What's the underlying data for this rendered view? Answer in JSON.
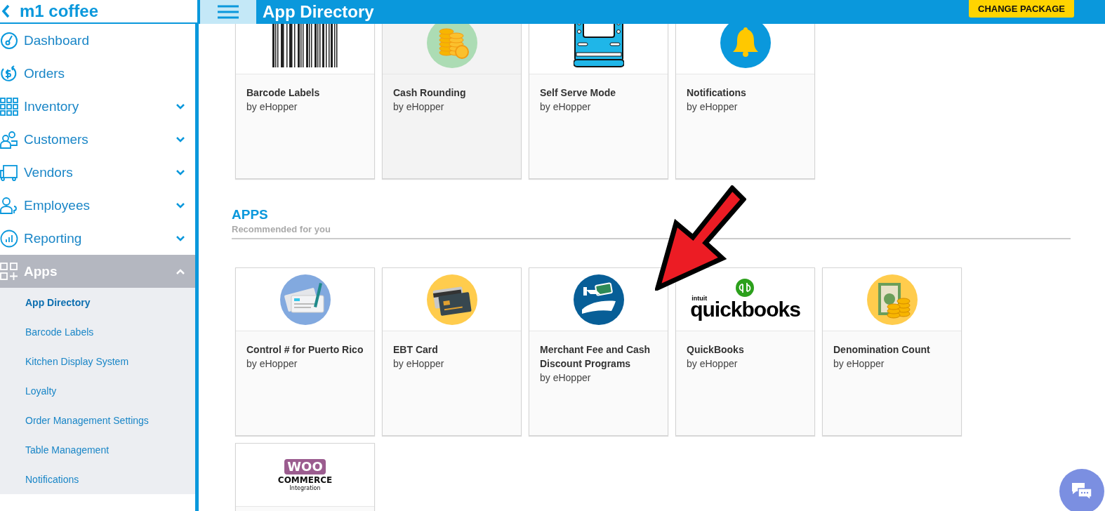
{
  "topbar": {
    "store_name": "m1 coffee",
    "title": "App Directory",
    "action": "CHANGE PACKAGE"
  },
  "sidebar": {
    "items": [
      {
        "kind": "link",
        "label": "Dashboard",
        "selected": false
      },
      {
        "kind": "link",
        "label": "Orders",
        "selected": false
      },
      {
        "kind": "group",
        "label": "Inventory",
        "selected": false,
        "expanded": false
      },
      {
        "kind": "group",
        "label": "Customers",
        "selected": false,
        "expanded": false
      },
      {
        "kind": "group",
        "label": "Vendors",
        "selected": false,
        "expanded": false
      },
      {
        "kind": "group",
        "label": "Employees",
        "selected": false,
        "expanded": false
      },
      {
        "kind": "group",
        "label": "Reporting",
        "selected": false,
        "expanded": false
      },
      {
        "kind": "group",
        "label": "Apps",
        "selected": true,
        "expanded": true,
        "children": [
          {
            "label": "App Directory",
            "selected": true
          },
          {
            "label": "Barcode Labels",
            "selected": false
          },
          {
            "label": "Kitchen Display System",
            "selected": false
          },
          {
            "label": "Loyalty",
            "selected": false
          },
          {
            "label": "Order Management Settings",
            "selected": false
          },
          {
            "label": "Table Management",
            "selected": false
          },
          {
            "label": "Notifications",
            "selected": false
          }
        ]
      }
    ]
  },
  "top_cards": [
    {
      "kind": "icon",
      "title": "Barcode Labels",
      "vendor": "by eHopper",
      "highlighted": false
    },
    {
      "kind": "icon",
      "title": "Cash Rounding",
      "vendor": "by eHopper",
      "highlighted": true
    },
    {
      "kind": "icon",
      "title": "Self Serve Mode",
      "vendor": "by eHopper",
      "highlighted": false
    },
    {
      "kind": "icon",
      "title": "Notifications",
      "vendor": "by eHopper",
      "highlighted": false
    }
  ],
  "apps_section": {
    "title": "APPS",
    "subtitle": "Recommended for you",
    "cards": [
      {
        "kind": "icon",
        "title": "Control # for Puerto Rico",
        "vendor": "by eHopper",
        "highlighted": false
      },
      {
        "kind": "icon",
        "title": "EBT Card",
        "vendor": "by eHopper",
        "highlighted": false
      },
      {
        "kind": "icon",
        "title": "Merchant Fee and Cash Discount Programs",
        "vendor": "by eHopper",
        "highlighted": false
      },
      {
        "kind": "quickbooks-logo",
        "logo_small": "intuit",
        "logo_text": "quickbooks",
        "title": "QuickBooks",
        "vendor": "by eHopper",
        "highlighted": false
      },
      {
        "kind": "icon",
        "title": "Denomination Count",
        "vendor": "by eHopper",
        "highlighted": false
      },
      {
        "kind": "woo-logo",
        "logo_text": "WOO",
        "logo_small": "COMMERCE",
        "logo_caption": "Integration",
        "highlighted": false
      }
    ]
  }
}
